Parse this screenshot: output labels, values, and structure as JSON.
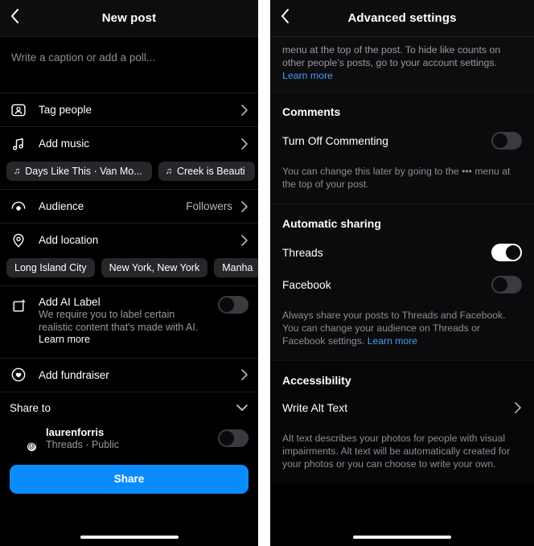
{
  "left": {
    "nav": {
      "back_icon": "chevron-left-icon",
      "title": "New post"
    },
    "caption": {
      "placeholder": "Write a caption or add a poll..."
    },
    "rows": [
      {
        "icon": "tag-people-icon",
        "label": "Tag people",
        "value": "",
        "accessory": "chevron-right-icon"
      },
      {
        "icon": "music-note-icon",
        "label": "Add music",
        "value": "",
        "accessory": "chevron-right-icon"
      },
      {
        "icon": "audience-icon",
        "label": "Audience",
        "value": "Followers",
        "accessory": "chevron-right-icon"
      },
      {
        "icon": "location-pin-icon",
        "label": "Add location",
        "value": "",
        "accessory": "chevron-right-icon"
      }
    ],
    "music_chips": [
      {
        "icon": "music-note-icon",
        "label": "Days Like This · Van Mo..."
      },
      {
        "icon": "music-note-icon",
        "label": "Creek is Beauti"
      }
    ],
    "location_chips": [
      {
        "label": "Long Island City"
      },
      {
        "label": "New York, New York"
      },
      {
        "label": "Manha"
      }
    ],
    "ai_label": {
      "icon": "ai-label-icon",
      "title": "Add AI Label",
      "description": "We require you to label certain realistic content that's made with AI. ",
      "learn_more": "Learn more",
      "toggle_state": "off"
    },
    "fundraiser": {
      "icon": "fundraiser-heart-icon",
      "label": "Add fundraiser",
      "accessory": "chevron-right-icon"
    },
    "share_to": {
      "title": "Share to",
      "accessory": "chevron-down-icon",
      "account": {
        "avatar": "user-avatar",
        "badge_icon": "threads-badge-icon",
        "badge_glyph": "@",
        "name": "laurenforris",
        "subtitle": "Threads · Public",
        "toggle_state": "off"
      },
      "share_button": "Share"
    }
  },
  "right": {
    "nav": {
      "back_icon": "chevron-left-icon",
      "title": "Advanced settings"
    },
    "intro": {
      "text": "menu at the top of the post. To hide like counts on other people's posts, go to your account settings. ",
      "learn_more": "Learn more"
    },
    "comments": {
      "title": "Comments",
      "setting_label": "Turn Off Commenting",
      "toggle_state": "off",
      "helper": "You can change this later by going to the ••• menu at the top of your post."
    },
    "automatic_sharing": {
      "title": "Automatic sharing",
      "items": [
        {
          "label": "Threads",
          "toggle_state": "on"
        },
        {
          "label": "Facebook",
          "toggle_state": "off"
        }
      ],
      "helper": "Always share your posts to Threads and Facebook. You can change your audience on Threads or Facebook settings. ",
      "learn_more": "Learn more"
    },
    "accessibility": {
      "title": "Accessibility",
      "row_label": "Write Alt Text",
      "accessory": "chevron-right-icon",
      "description": "Alt text describes your photos for people with visual impairments. Alt text will be automatically created for your photos or you can choose to write your own."
    }
  },
  "colors": {
    "accent_blue": "#0a8cff",
    "link_blue": "#4a9bf0",
    "background": "#000000",
    "chip": "#26262b",
    "toggle_off": "#3a3a40",
    "toggle_on": "#ffffff"
  }
}
